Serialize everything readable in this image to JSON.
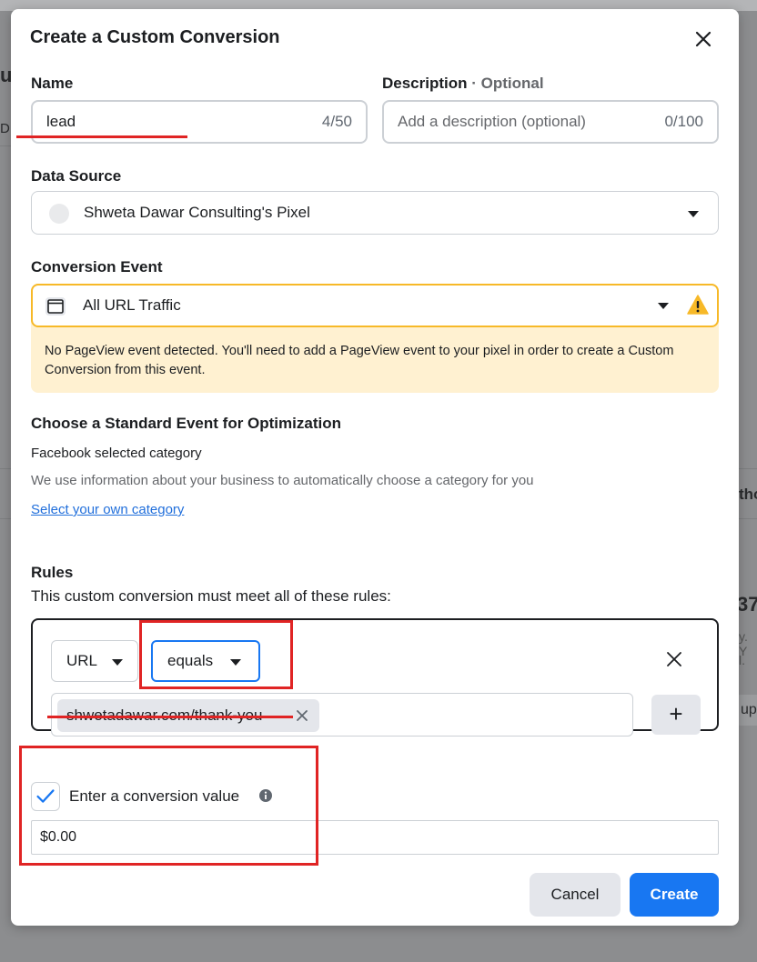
{
  "background": {
    "fragments": [
      "u",
      "D",
      "tho",
      "37",
      "y. Y",
      "l.",
      "up"
    ]
  },
  "modal": {
    "title": "Create a Custom Conversion",
    "close_icon": "close-icon"
  },
  "form": {
    "name": {
      "label": "Name",
      "value": "lead",
      "counter": "4/50"
    },
    "description": {
      "label": "Description",
      "optional_suffix": "· Optional",
      "placeholder": "Add a description (optional)",
      "counter": "0/100"
    },
    "data_source": {
      "label": "Data Source",
      "selected": "Shweta Dawar Consulting's Pixel"
    },
    "conversion_event": {
      "label": "Conversion Event",
      "selected": "All URL Traffic",
      "warning": "No PageView event detected. You'll need to add a PageView event to your pixel in order to create a Custom Conversion from this event."
    },
    "standard_event": {
      "heading": "Choose a Standard Event for Optimization",
      "subheading": "Facebook selected category",
      "description": "We use information about your business to automatically choose a category for you",
      "link": "Select your own category"
    },
    "rules": {
      "heading": "Rules",
      "description": "This custom conversion must meet all of these rules:",
      "field": "URL",
      "operator": "equals",
      "value": "shwetadawar.com/thank-you",
      "value_placeholder": ""
    },
    "conversion_value": {
      "checkbox_label": "Enter a conversion value",
      "checked": true,
      "value": "$0.00"
    }
  },
  "footer": {
    "cancel_label": "Cancel",
    "create_label": "Create"
  },
  "colors": {
    "primary": "#1877f2",
    "warning_bg": "#fff1d1",
    "warning_border": "#f7b928",
    "annotation": "#e02424"
  }
}
